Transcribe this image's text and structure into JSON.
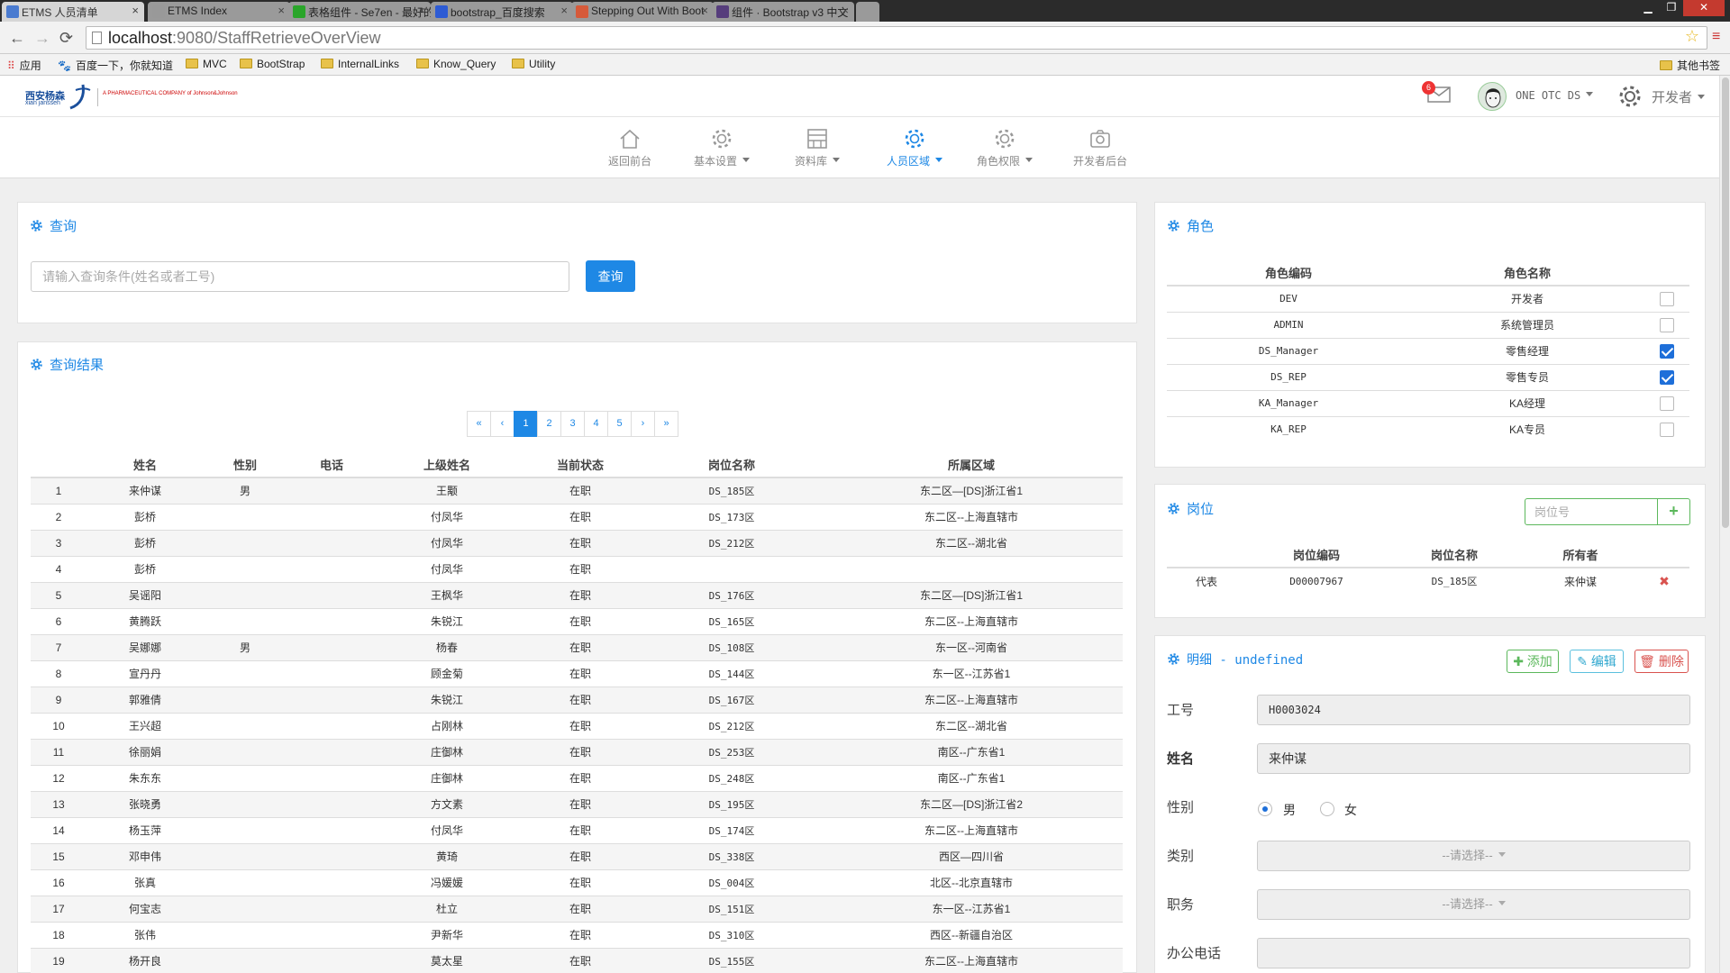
{
  "browser": {
    "tabs": [
      {
        "title": "ETMS 人员清单",
        "color": "#4a7bd0"
      },
      {
        "title": "ETMS Index",
        "color": "#999999"
      },
      {
        "title": "表格组件 - Se7en - 最好的",
        "color": "#2aa52a"
      },
      {
        "title": "bootstrap_百度搜索",
        "color": "#2d5bd4"
      },
      {
        "title": "Stepping Out With Boot",
        "color": "#d65a3a"
      },
      {
        "title": "组件 · Bootstrap v3 中文",
        "color": "#563d7c"
      }
    ],
    "url_host": "localhost",
    "url_rest": ":9080/StaffRetrieveOverView",
    "bookmarks": [
      {
        "label": "应用",
        "type": "apps"
      },
      {
        "label": "百度一下，你就知道",
        "type": "page"
      },
      {
        "label": "MVC",
        "type": "folder"
      },
      {
        "label": "BootStrap",
        "type": "folder"
      },
      {
        "label": "InternalLinks",
        "type": "folder"
      },
      {
        "label": "Know_Query",
        "type": "folder"
      },
      {
        "label": "Utility",
        "type": "folder"
      }
    ],
    "other_bookmarks": "其他书签"
  },
  "header": {
    "logo_cn": "西安杨森",
    "logo_en": "xian janssen",
    "logo_jj": "A PHARMACEUTICAL COMPANY of Johnson&Johnson",
    "mail_count": "6",
    "username": "ONE OTC DS",
    "role_menu": "开发者"
  },
  "nav": {
    "items": [
      {
        "label": "返回前台",
        "icon": "home-icon",
        "caret": false,
        "active": false
      },
      {
        "label": "基本设置",
        "icon": "gear-icon",
        "caret": true,
        "active": false
      },
      {
        "label": "资料库",
        "icon": "database-icon",
        "caret": true,
        "active": false
      },
      {
        "label": "人员区域",
        "icon": "gear-icon",
        "caret": true,
        "active": true
      },
      {
        "label": "角色权限",
        "icon": "gear-icon",
        "caret": true,
        "active": false
      },
      {
        "label": "开发者后台",
        "icon": "camera-icon",
        "caret": false,
        "active": false
      }
    ]
  },
  "query": {
    "title": "查询",
    "placeholder": "请输入查询条件(姓名或者工号)",
    "button": "查询"
  },
  "results": {
    "title": "查询结果",
    "pager": [
      "«",
      "‹",
      "1",
      "2",
      "3",
      "4",
      "5",
      "›",
      "»"
    ],
    "active_page": "1",
    "columns": [
      "",
      "姓名",
      "性别",
      "电话",
      "上级姓名",
      "当前状态",
      "岗位名称",
      "所属区域"
    ],
    "rows": [
      [
        "1",
        "来仲谋",
        "男",
        "",
        "王颙",
        "在职",
        "DS_185区",
        "东二区—[DS]浙江省1"
      ],
      [
        "2",
        "彭桥",
        "",
        "",
        "付凤华",
        "在职",
        "DS_173区",
        "东二区--上海直辖市"
      ],
      [
        "3",
        "彭桥",
        "",
        "",
        "付凤华",
        "在职",
        "DS_212区",
        "东二区--湖北省"
      ],
      [
        "4",
        "彭桥",
        "",
        "",
        "付凤华",
        "在职",
        "",
        ""
      ],
      [
        "5",
        "吴谣阳",
        "",
        "",
        "王枫华",
        "在职",
        "DS_176区",
        "东二区—[DS]浙江省1"
      ],
      [
        "6",
        "黄腾跃",
        "",
        "",
        "朱锐江",
        "在职",
        "DS_165区",
        "东二区--上海直辖市"
      ],
      [
        "7",
        "吴娜娜",
        "男",
        "",
        "杨春",
        "在职",
        "DS_108区",
        "东一区--河南省"
      ],
      [
        "8",
        "宣丹丹",
        "",
        "",
        "顾金菊",
        "在职",
        "DS_144区",
        "东一区--江苏省1"
      ],
      [
        "9",
        "郭雅倩",
        "",
        "",
        "朱锐江",
        "在职",
        "DS_167区",
        "东二区--上海直辖市"
      ],
      [
        "10",
        "王兴超",
        "",
        "",
        "占刚林",
        "在职",
        "DS_212区",
        "东二区--湖北省"
      ],
      [
        "11",
        "徐丽娟",
        "",
        "",
        "庄御林",
        "在职",
        "DS_253区",
        "南区--广东省1"
      ],
      [
        "12",
        "朱东东",
        "",
        "",
        "庄御林",
        "在职",
        "DS_248区",
        "南区--广东省1"
      ],
      [
        "13",
        "张晓勇",
        "",
        "",
        "方文素",
        "在职",
        "DS_195区",
        "东二区—[DS]浙江省2"
      ],
      [
        "14",
        "杨玉萍",
        "",
        "",
        "付凤华",
        "在职",
        "DS_174区",
        "东二区--上海直辖市"
      ],
      [
        "15",
        "邓申伟",
        "",
        "",
        "黄琦",
        "在职",
        "DS_338区",
        "西区—四川省"
      ],
      [
        "16",
        "张真",
        "",
        "",
        "冯媛媛",
        "在职",
        "DS_004区",
        "北区--北京直辖市"
      ],
      [
        "17",
        "何宝志",
        "",
        "",
        "杜立",
        "在职",
        "DS_151区",
        "东一区--江苏省1"
      ],
      [
        "18",
        "张伟",
        "",
        "",
        "尹新华",
        "在职",
        "DS_310区",
        "西区--新疆自治区"
      ],
      [
        "19",
        "杨开良",
        "",
        "",
        "莫太星",
        "在职",
        "DS_155区",
        "东二区--上海直辖市"
      ]
    ]
  },
  "roles": {
    "title": "角色",
    "columns": [
      "角色编码",
      "角色名称",
      ""
    ],
    "rows": [
      {
        "code": "DEV",
        "name": "开发者",
        "checked": false
      },
      {
        "code": "ADMIN",
        "name": "系统管理员",
        "checked": false
      },
      {
        "code": "DS_Manager",
        "name": "零售经理",
        "checked": true
      },
      {
        "code": "DS_REP",
        "name": "零售专员",
        "checked": true
      },
      {
        "code": "KA_Manager",
        "name": "KA经理",
        "checked": false
      },
      {
        "code": "KA_REP",
        "name": "KA专员",
        "checked": false
      }
    ]
  },
  "posts": {
    "title": "岗位",
    "placeholder": "岗位号",
    "add": "+",
    "columns": [
      "",
      "岗位编码",
      "岗位名称",
      "所有者",
      ""
    ],
    "rows": [
      {
        "type": "代表",
        "code": "D00007967",
        "name": "DS_185区",
        "owner": "来仲谋",
        "del": "✖"
      }
    ]
  },
  "detail": {
    "title": "明细 - undefined",
    "add": "添加",
    "edit": "编辑",
    "delete": "删除",
    "employee_id_label": "工号",
    "employee_id": "H0003024",
    "name_label": "姓名",
    "name": "来仲谋",
    "gender_label": "性别",
    "gender_male": "男",
    "gender_female": "女",
    "category_label": "类别",
    "category_value": "--请选择--",
    "position_label": "职务",
    "position_value": "--请选择--",
    "phone_label": "办公电话",
    "phone": ""
  }
}
